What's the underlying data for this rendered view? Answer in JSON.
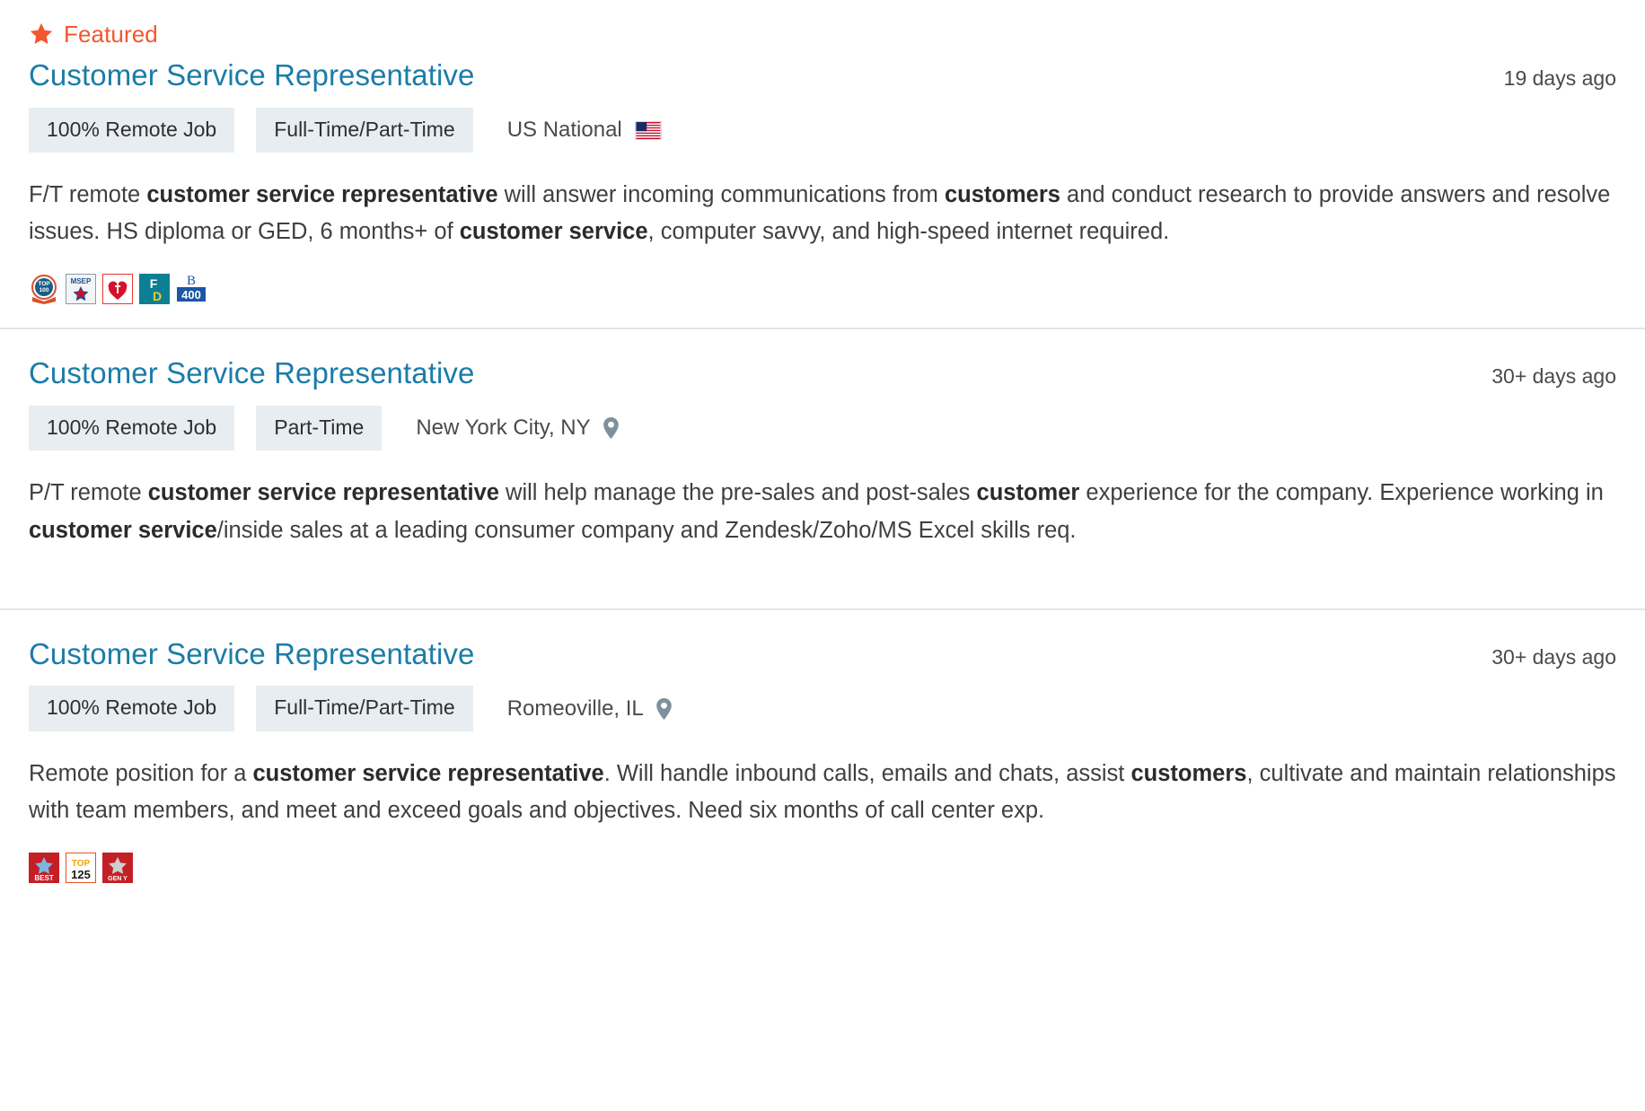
{
  "listings": [
    {
      "featured": true,
      "featured_label": "Featured",
      "featured_icon": "star-icon",
      "title": "Customer Service Representative",
      "posted": "19 days ago",
      "tags": [
        "100% Remote Job",
        "Full-Time/Part-Time"
      ],
      "location": "US National",
      "location_icon": "us-flag-icon",
      "description_parts": [
        {
          "text": "F/T remote ",
          "bold": false
        },
        {
          "text": "customer service representative",
          "bold": true
        },
        {
          "text": " will answer incoming communications from ",
          "bold": false
        },
        {
          "text": "customers",
          "bold": true
        },
        {
          "text": " and conduct research to provide answers and resolve issues. HS diploma or GED, 6 months+ of ",
          "bold": false
        },
        {
          "text": "customer service",
          "bold": true
        },
        {
          "text": ", computer savvy, and high-speed internet required.",
          "bold": false
        }
      ],
      "badges": [
        {
          "name": "top-100-badge",
          "label": "TOP 100"
        },
        {
          "name": "msep-badge",
          "label": "MSEP"
        },
        {
          "name": "american-heart-association-badge",
          "label": "AHA"
        },
        {
          "name": "fortune-diversity-badge",
          "label": "FD"
        },
        {
          "name": "b-400-badge",
          "label": "B 400"
        }
      ]
    },
    {
      "featured": false,
      "title": "Customer Service Representative",
      "posted": "30+ days ago",
      "tags": [
        "100% Remote Job",
        "Part-Time"
      ],
      "location": "New York City, NY",
      "location_icon": "map-pin-icon",
      "description_parts": [
        {
          "text": "P/T remote ",
          "bold": false
        },
        {
          "text": "customer service representative",
          "bold": true
        },
        {
          "text": " will help manage the pre-sales and post-sales ",
          "bold": false
        },
        {
          "text": "customer",
          "bold": true
        },
        {
          "text": " experience for the company. Experience working in ",
          "bold": false
        },
        {
          "text": "customer service",
          "bold": true
        },
        {
          "text": "/inside sales at a leading consumer company and Zendesk/Zoho/MS Excel skills req.",
          "bold": false
        }
      ],
      "badges": []
    },
    {
      "featured": false,
      "title": "Customer Service Representative",
      "posted": "30+ days ago",
      "tags": [
        "100% Remote Job",
        "Full-Time/Part-Time"
      ],
      "location": "Romeoville, IL",
      "location_icon": "map-pin-icon",
      "description_parts": [
        {
          "text": "Remote position for a ",
          "bold": false
        },
        {
          "text": "customer service representative",
          "bold": true
        },
        {
          "text": ". Will handle inbound calls, emails and chats, assist ",
          "bold": false
        },
        {
          "text": "customers",
          "bold": true
        },
        {
          "text": ", cultivate and maintain relationships with team members, and meet and exceed goals and objectives. Need six months of call center exp.",
          "bold": false
        }
      ],
      "badges": [
        {
          "name": "best-badge",
          "label": "BEST"
        },
        {
          "name": "top-125-badge",
          "label": "TOP 125"
        },
        {
          "name": "gen-y-badge",
          "label": "GEN Y"
        }
      ]
    }
  ],
  "colors": {
    "title_link": "#1b7ca8",
    "featured": "#f4562e",
    "tag_background": "#e7edf1",
    "divider": "#e3e5e7",
    "body_text": "#3f3f3f",
    "pin": "#7d909b"
  }
}
